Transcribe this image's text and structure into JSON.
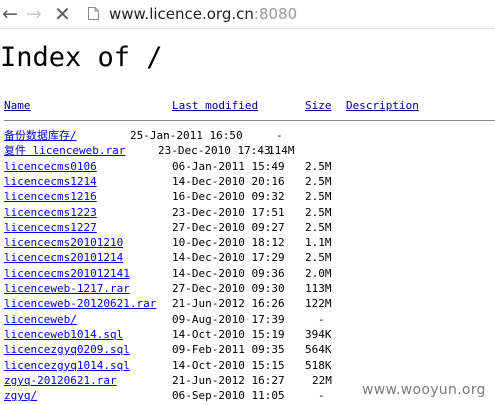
{
  "browser": {
    "url_host": "www.licence.org.cn",
    "url_port": ":8080",
    "back_icon": "arrow-left-icon",
    "forward_icon": "arrow-right-icon",
    "stop_icon": "close-icon",
    "page_icon": "page-icon"
  },
  "page": {
    "title": "Index of /",
    "columns": {
      "name": "Name",
      "last_modified": "Last modified",
      "size": "Size",
      "description": "Description"
    },
    "rows": [
      {
        "name": "备份数据库存/",
        "date": "25-Jan-2011 16:50",
        "size": "-"
      },
      {
        "name": "复件 licenceweb.rar",
        "date": "23-Dec-2010 17:43",
        "size": "114M"
      },
      {
        "name": "licencecms0106",
        "date": "06-Jan-2011 15:49",
        "size": "2.5M"
      },
      {
        "name": "licencecms1214",
        "date": "14-Dec-2010 20:16",
        "size": "2.5M"
      },
      {
        "name": "licencecms1216",
        "date": "16-Dec-2010 09:32",
        "size": "2.5M"
      },
      {
        "name": "licencecms1223",
        "date": "23-Dec-2010 17:51",
        "size": "2.5M"
      },
      {
        "name": "licencecms1227",
        "date": "27-Dec-2010 09:27",
        "size": "2.5M"
      },
      {
        "name": "licencecms20101210",
        "date": "10-Dec-2010 18:12",
        "size": "1.1M"
      },
      {
        "name": "licencecms20101214",
        "date": "14-Dec-2010 17:29",
        "size": "2.5M"
      },
      {
        "name": "licencecms201012141",
        "date": "14-Dec-2010 09:36",
        "size": "2.0M"
      },
      {
        "name": "licenceweb-1217.rar",
        "date": "27-Dec-2010 09:30",
        "size": "113M"
      },
      {
        "name": "licenceweb-20120621.rar",
        "date": "21-Jun-2012 16:26",
        "size": "122M"
      },
      {
        "name": "licenceweb/",
        "date": "09-Aug-2010 17:39",
        "size": "-"
      },
      {
        "name": "licenceweb1014.sql",
        "date": "14-Oct-2010 15:19",
        "size": "394K"
      },
      {
        "name": "licencezgyq0209.sql",
        "date": "09-Feb-2011 09:35",
        "size": "564K"
      },
      {
        "name": "licencezgyq1014.sql",
        "date": "14-Oct-2010 15:15",
        "size": "518K"
      },
      {
        "name": "zgyq-20120621.rar",
        "date": "21-Jun-2012 16:27",
        "size": "22M"
      },
      {
        "name": "zgyq/",
        "date": "06-Sep-2010 11:05",
        "size": "-"
      }
    ]
  },
  "watermark": "www.wooyun.org"
}
